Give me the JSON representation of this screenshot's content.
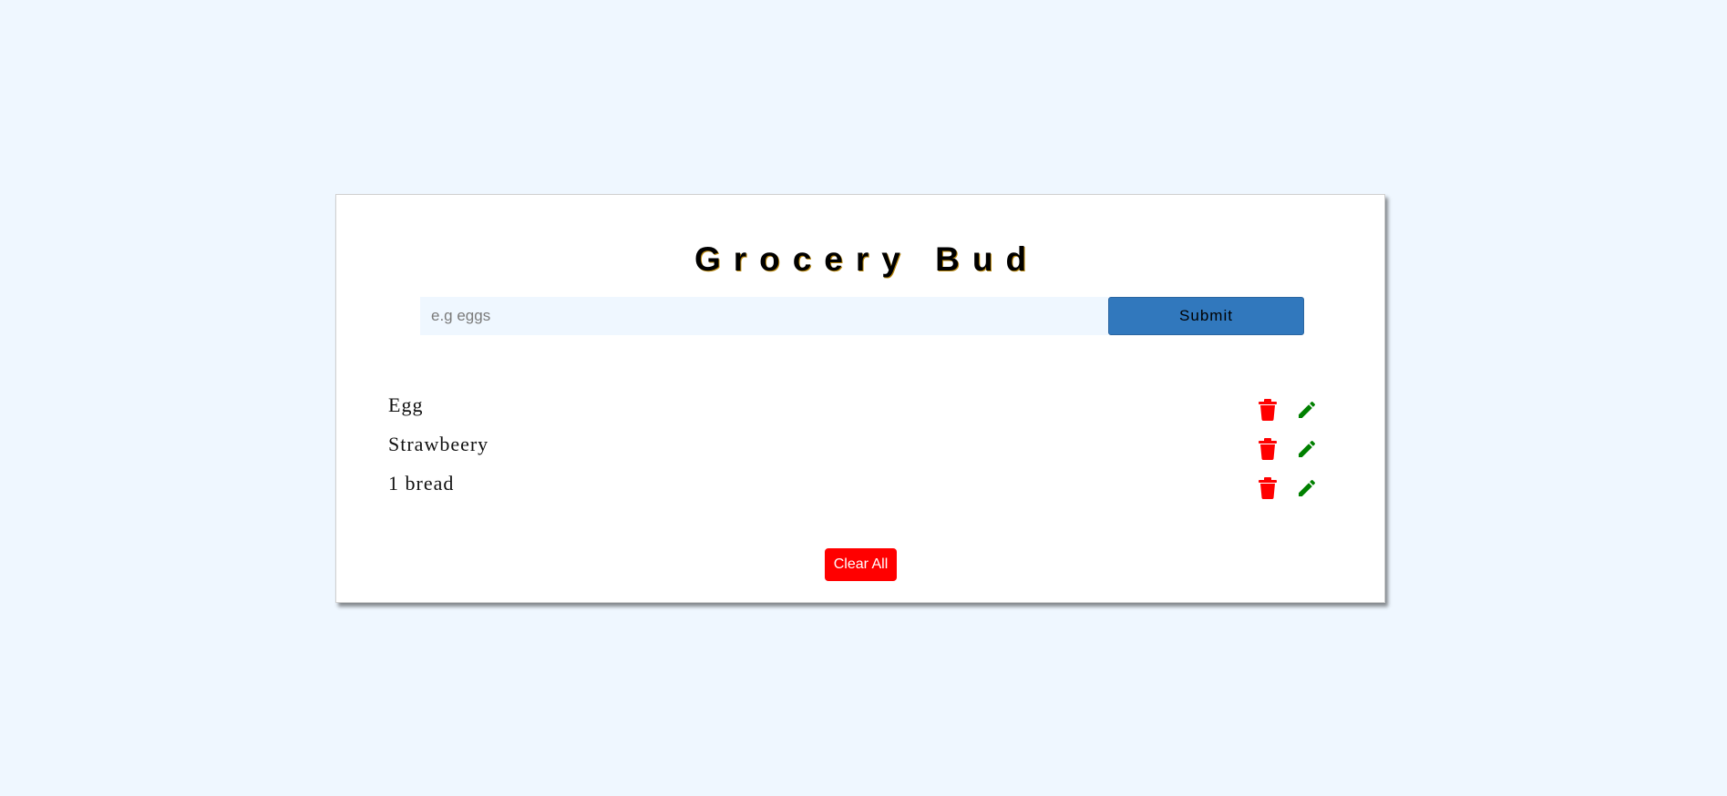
{
  "app": {
    "title": "Grocery Bud"
  },
  "form": {
    "input_value": "",
    "input_placeholder": "e.g eggs",
    "submit_label": "Submit"
  },
  "items": [
    {
      "name": "Egg"
    },
    {
      "name": "Strawbeery"
    },
    {
      "name": "1 bread"
    }
  ],
  "icons": {
    "delete": "trash-icon",
    "edit": "pencil-icon"
  },
  "clear_label": "Clear All",
  "colors": {
    "background": "#eff7ff",
    "submit": "#3178bd",
    "delete": "#ff0000",
    "edit": "#008000",
    "clear": "#ff0000"
  }
}
